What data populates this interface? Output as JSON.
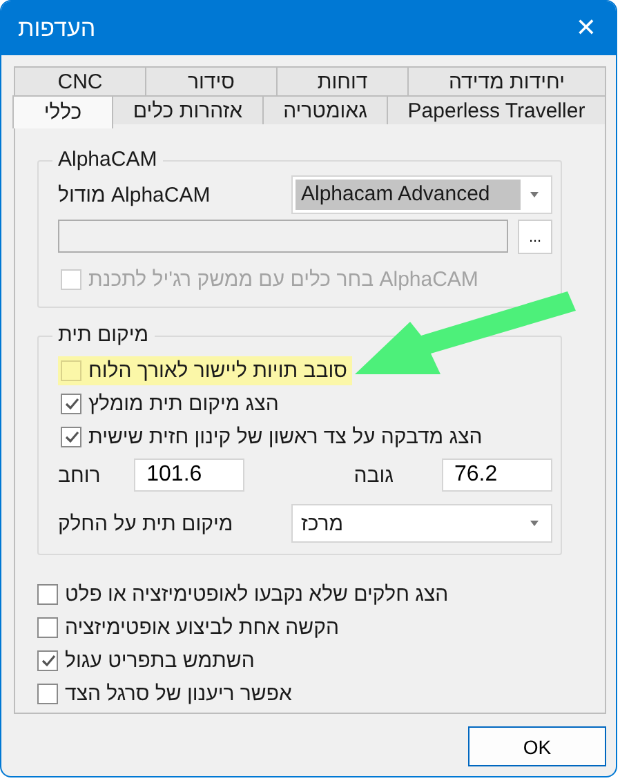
{
  "window": {
    "title": "העדפות",
    "close": "✕"
  },
  "tab_rows": [
    [
      {
        "label": "יחידות מדידה",
        "selected": false
      },
      {
        "label": "דוחות",
        "selected": false
      },
      {
        "label": "סידור",
        "selected": false
      },
      {
        "label": "CNC",
        "selected": false
      }
    ],
    [
      {
        "label": "Paperless Traveller",
        "selected": false
      },
      {
        "label": "גאומטריה",
        "selected": false
      },
      {
        "label": "אזהרות כלים",
        "selected": false
      },
      {
        "label": "כללי",
        "selected": true
      }
    ]
  ],
  "alphacam_group": {
    "title": "AlphaCAM",
    "module_label": "מודול AlphaCAM",
    "module_value": "Alphacam Advanced",
    "browse_button": "...",
    "option": {
      "label": "בחר כלים עם ממשק רג'יל לתכנת AlphaCAM",
      "checked": false,
      "disabled": true,
      "highlighted": false
    }
  },
  "label_group": {
    "title": "מיקום תית",
    "options": [
      {
        "label": "סובב תויות ליישור לאורך הלוח",
        "checked": false,
        "disabled": false,
        "highlighted": true
      },
      {
        "label": "הצג מיקום תית מומלץ",
        "checked": true,
        "disabled": false,
        "highlighted": false
      },
      {
        "label": "הצג מדבקה על צד ראשון של קינון חזית שישית",
        "checked": true,
        "disabled": false,
        "highlighted": false
      }
    ],
    "width_label": "רוחב",
    "width_value": "101.6",
    "height_label": "גובה",
    "height_value": "76.2",
    "position_label": "מיקום תית על החלק",
    "position_value": "מרכז"
  },
  "options": [
    {
      "label": "הצג חלקים שלא נקבעו לאופטימיזציה או פלט",
      "checked": false,
      "disabled": false,
      "highlighted": false
    },
    {
      "label": "הקשה אחת לביצוע אופטימיזציה",
      "checked": false,
      "disabled": false,
      "highlighted": false
    },
    {
      "label": "השתמש בתפריט עגול",
      "checked": true,
      "disabled": false,
      "highlighted": false
    },
    {
      "label": "אפשר ריענון של סרגל הצד",
      "checked": false,
      "disabled": false,
      "highlighted": false
    }
  ],
  "annotation": {
    "kind": "arrow"
  },
  "buttons": [
    "OK"
  ]
}
